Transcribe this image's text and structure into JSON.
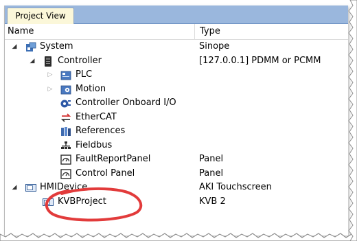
{
  "window": {
    "tab_label": "Project View"
  },
  "columns": {
    "name": "Name",
    "type": "Type"
  },
  "tree": {
    "system": {
      "label": "System",
      "type": "Sinope"
    },
    "controller": {
      "label": "Controller",
      "type": "[127.0.0.1] PDMM or PCMM"
    },
    "plc": {
      "label": "PLC"
    },
    "motion": {
      "label": "Motion"
    },
    "onboard_io": {
      "label": "Controller Onboard I/O"
    },
    "ethercat": {
      "label": "EtherCAT"
    },
    "references": {
      "label": "References"
    },
    "fieldbus": {
      "label": "Fieldbus"
    },
    "fault_panel": {
      "label": "FaultReportPanel",
      "type": "Panel"
    },
    "control_panel": {
      "label": "Control Panel",
      "type": "Panel"
    },
    "hmi_device": {
      "label": "HMIDevice",
      "type": "AKI Touchscreen"
    },
    "kvb_project": {
      "label": "KVBProject",
      "type": "KVB 2"
    }
  },
  "icons": {
    "system": "system-icon",
    "controller": "controller-icon",
    "plc": "plc-icon",
    "motion": "motion-icon",
    "onboard_io": "onboard-io-icon",
    "ethercat": "ethercat-icon",
    "references": "references-icon",
    "fieldbus": "fieldbus-icon",
    "panel": "panel-icon",
    "hmi": "hmi-device-icon"
  },
  "colors": {
    "tab_strip": "#9ab7dd",
    "tab_active": "#fbf7d9",
    "annotation_circle": "#e23b3b"
  }
}
